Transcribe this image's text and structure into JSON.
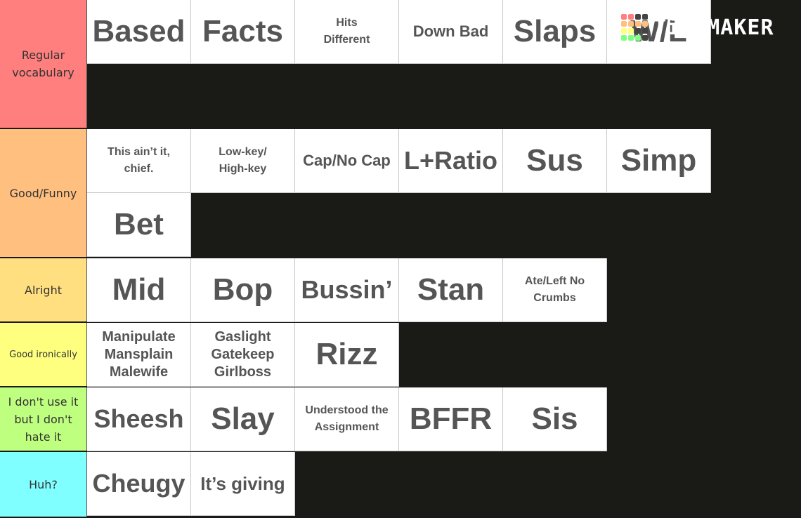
{
  "brand": {
    "name": "TiERMAKER"
  },
  "logo_colors": [
    [
      "#ff7f7f",
      "#ff7f7f",
      "#444444",
      "#444444"
    ],
    [
      "#ffbf7f",
      "#ffbf7f",
      "#ffbf7f",
      "#ffbf7f"
    ],
    [
      "#ffff7f",
      "#ffff7f",
      "#444444",
      "#444444"
    ],
    [
      "#7fff7f",
      "#7fff7f",
      "#7fff7f",
      "#444444"
    ]
  ],
  "tiers": [
    {
      "label": "Regular vocabulary",
      "color": "#ff7f7f",
      "rows": 2,
      "items": [
        "Based",
        "Facts",
        "Hits\nDifferent",
        "Down Bad",
        "Slaps",
        "W/L"
      ]
    },
    {
      "label": "Good/Funny",
      "color": "#ffbf7f",
      "rows": 2,
      "items": [
        "This ain’t it,\nchief.",
        "Low-key/\nHigh-key",
        "Cap/No Cap",
        "L+Ratio",
        "Sus",
        "Simp",
        "Bet"
      ]
    },
    {
      "label": "Alright",
      "color": "#ffdf7f",
      "rows": 1,
      "items": [
        "Mid",
        "Bop",
        "Bussin’",
        "Stan",
        "Ate/Left No\nCrumbs"
      ]
    },
    {
      "label": "Good ironically",
      "color": "#ffff7f",
      "rows": 1,
      "items": [
        "Manipulate\nMansplain\nMalewife",
        "Gaslight\nGatekeep\nGirlboss",
        "Rizz"
      ]
    },
    {
      "label": "I don't use it but I don't hate it",
      "color": "#bfff7f",
      "rows": 1,
      "items": [
        "Sheesh",
        "Slay",
        "Understood the\nAssignment",
        "BFFR",
        "Sis"
      ]
    },
    {
      "label": "Huh?",
      "color": "#7fffff",
      "rows": 1,
      "items": [
        "Cheugy",
        "It’s giving"
      ]
    }
  ]
}
